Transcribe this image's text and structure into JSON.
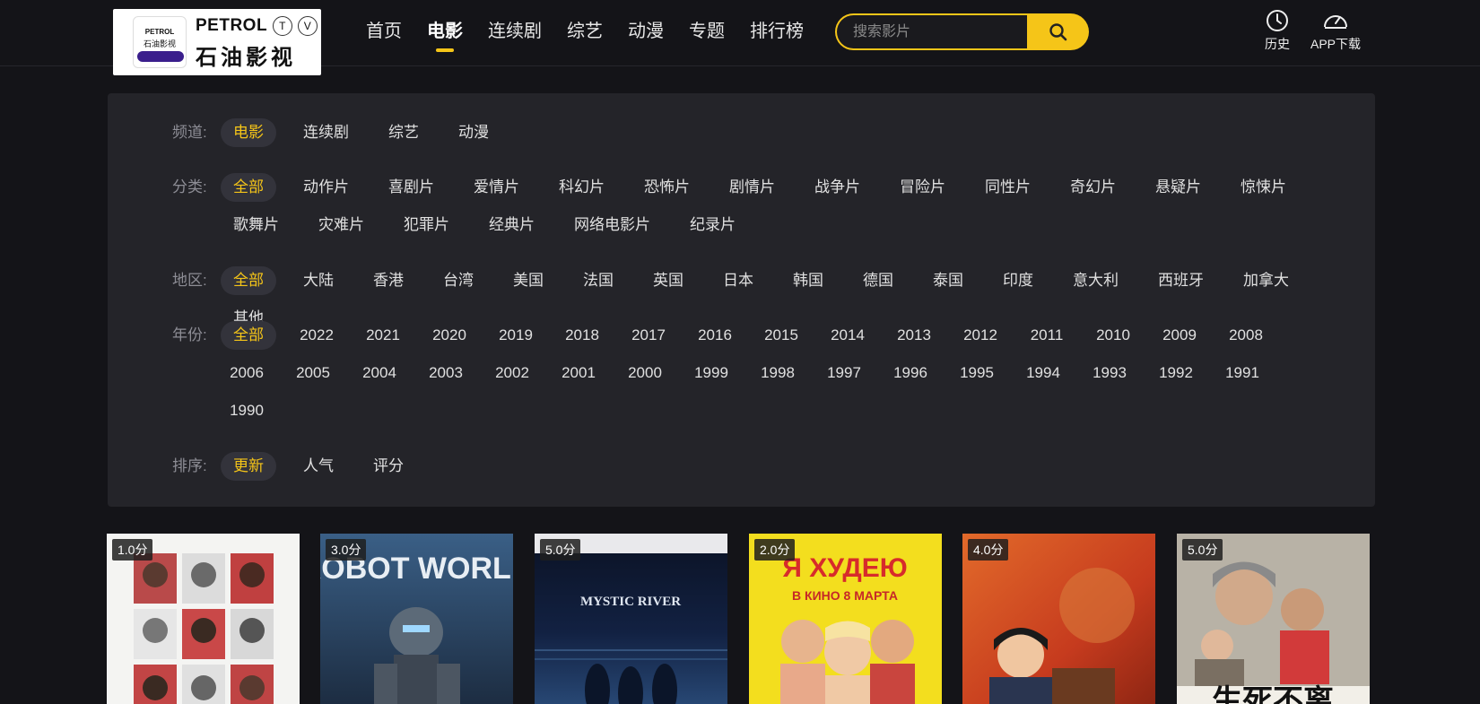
{
  "header": {
    "logo": {
      "badge_top": "PETROL",
      "badge_bottom": "石油影视",
      "brand": "PETROL",
      "brand_t": "T",
      "brand_v": "V",
      "cn": "石油影视"
    },
    "nav": [
      {
        "label": "首页",
        "active": false
      },
      {
        "label": "电影",
        "active": true
      },
      {
        "label": "连续剧",
        "active": false
      },
      {
        "label": "综艺",
        "active": false
      },
      {
        "label": "动漫",
        "active": false
      },
      {
        "label": "专题",
        "active": false
      },
      {
        "label": "排行榜",
        "active": false
      }
    ],
    "search": {
      "placeholder": "搜索影片",
      "icon": "search-icon"
    },
    "actions": [
      {
        "label": "历史",
        "icon": "clock-icon"
      },
      {
        "label": "APP下载",
        "icon": "gauge-icon"
      }
    ]
  },
  "filters": [
    {
      "label": "频道:",
      "options": [
        "电影",
        "连续剧",
        "综艺",
        "动漫"
      ],
      "selected": 0
    },
    {
      "label": "分类:",
      "options": [
        "全部",
        "动作片",
        "喜剧片",
        "爱情片",
        "科幻片",
        "恐怖片",
        "剧情片",
        "战争片",
        "冒险片",
        "同性片",
        "奇幻片",
        "悬疑片",
        "惊悚片",
        "歌舞片",
        "灾难片",
        "犯罪片",
        "经典片",
        "网络电影片",
        "纪录片"
      ],
      "selected": 0
    },
    {
      "label": "地区:",
      "options": [
        "全部",
        "大陆",
        "香港",
        "台湾",
        "美国",
        "法国",
        "英国",
        "日本",
        "韩国",
        "德国",
        "泰国",
        "印度",
        "意大利",
        "西班牙",
        "加拿大",
        "其他"
      ],
      "selected": 0
    },
    {
      "label": "年份:",
      "options": [
        "全部",
        "2022",
        "2021",
        "2020",
        "2019",
        "2018",
        "2017",
        "2016",
        "2015",
        "2014",
        "2013",
        "2012",
        "2011",
        "2010",
        "2009",
        "2008",
        "2006",
        "2005",
        "2004",
        "2003",
        "2002",
        "2001",
        "2000",
        "1999",
        "1998",
        "1997",
        "1996",
        "1995",
        "1994",
        "1993",
        "1992",
        "1991",
        "1990"
      ],
      "selected": 0
    },
    {
      "label": "排序:",
      "options": [
        "更新",
        "人气",
        "评分"
      ],
      "selected": 0
    }
  ],
  "posters": [
    {
      "score": "1.0分",
      "caption": ""
    },
    {
      "score": "3.0分",
      "caption": "ROBOT WORLD"
    },
    {
      "score": "5.0分",
      "caption": "MYSTIC RIVER"
    },
    {
      "score": "2.0分",
      "caption": "Я ХУДЕЮ",
      "caption2": "В КИНО 8 МАРТА"
    },
    {
      "score": "4.0分",
      "caption": ""
    },
    {
      "score": "5.0分",
      "caption": "生死不离"
    }
  ],
  "colors": {
    "accent": "#f5c518",
    "background": "#141418",
    "panel": "#242429"
  }
}
